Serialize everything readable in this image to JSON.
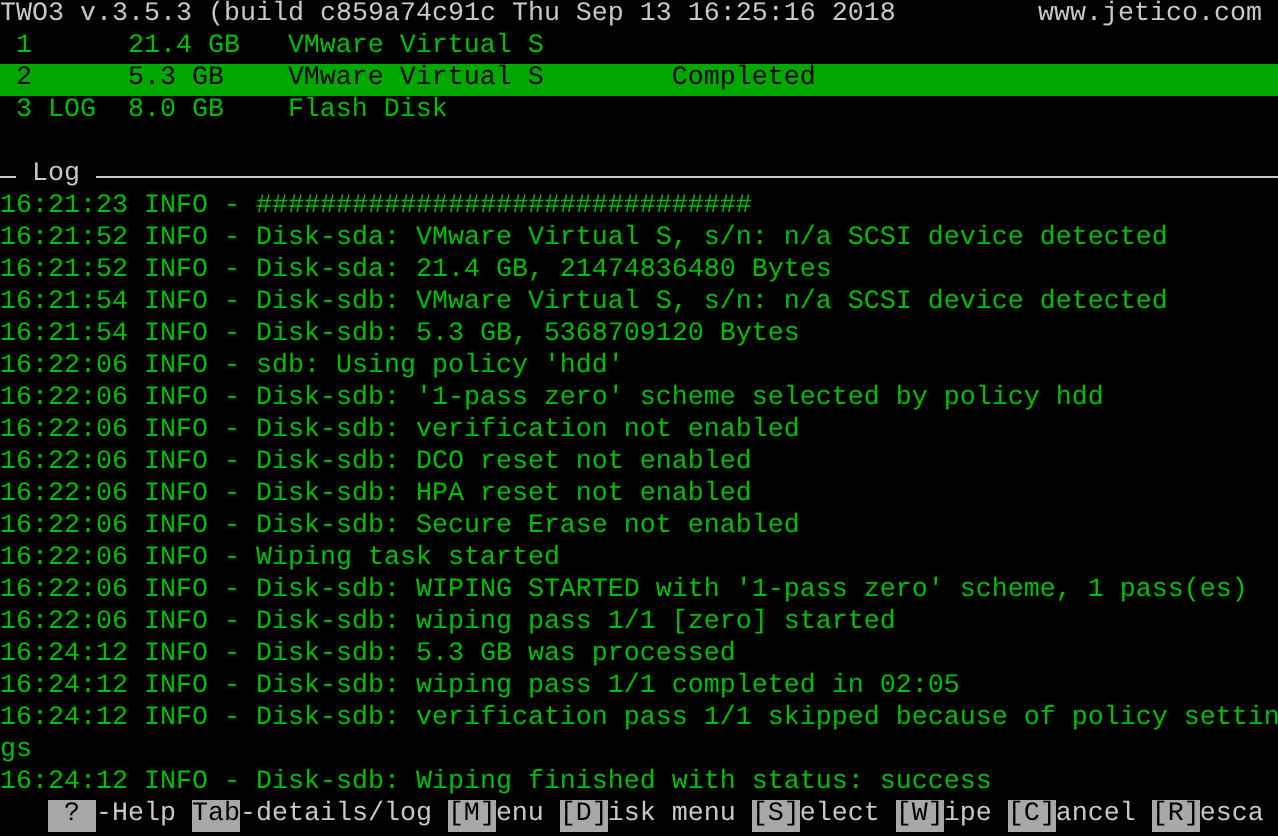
{
  "title_bar": {
    "title": "TWO3 v.3.5.3 (build c859a74c91c Thu Sep 13 16:25:16 2018",
    "website": "www.jetico.com"
  },
  "disks": [
    {
      "id": "1",
      "size": "21.4 GB",
      "name": "VMware Virtual S",
      "selected": false
    },
    {
      "id": "2",
      "size": "5.3 GB",
      "name": "VMware Virtual S",
      "status": "Completed",
      "selected": true
    },
    {
      "id": "3 LOG",
      "size": "8.0 GB",
      "name": "Flash Disk",
      "selected": false
    }
  ],
  "log": {
    "title": "Log",
    "lines": [
      "16:21:23 INFO - ###############################",
      "16:21:52 INFO - Disk-sda: VMware Virtual S, s/n: n/a SCSI device detected",
      "16:21:52 INFO - Disk-sda: 21.4 GB, 21474836480 Bytes",
      "16:21:54 INFO - Disk-sdb: VMware Virtual S, s/n: n/a SCSI device detected",
      "16:21:54 INFO - Disk-sdb: 5.3 GB, 5368709120 Bytes",
      "16:22:06 INFO - sdb: Using policy 'hdd'",
      "16:22:06 INFO - Disk-sdb: '1-pass zero' scheme selected by policy hdd",
      "16:22:06 INFO - Disk-sdb: verification not enabled",
      "16:22:06 INFO - Disk-sdb: DCO reset not enabled",
      "16:22:06 INFO - Disk-sdb: HPA reset not enabled",
      "16:22:06 INFO - Disk-sdb: Secure Erase not enabled",
      "16:22:06 INFO - Wiping task started",
      "16:22:06 INFO - Disk-sdb: WIPING STARTED with '1-pass zero' scheme, 1 pass(es)",
      "16:22:06 INFO - Disk-sdb: wiping pass 1/1 [zero] started",
      "16:24:12 INFO - Disk-sdb: 5.3 GB was processed",
      "16:24:12 INFO - Disk-sdb: wiping pass 1/1 completed in 02:05",
      "16:24:12 INFO - Disk-sdb: verification pass 1/1 skipped because of policy settin",
      "gs",
      "16:24:12 INFO - Disk-sdb: Wiping finished with status: success"
    ]
  },
  "key_bar": [
    {
      "key": " ? ",
      "label": "-Help"
    },
    {
      "key": "Tab",
      "label": "-details/log"
    },
    {
      "key": "[M]",
      "label": "enu"
    },
    {
      "key": "[D]",
      "label": "isk menu"
    },
    {
      "key": "[S]",
      "label": "elect"
    },
    {
      "key": "[W]",
      "label": "ipe"
    },
    {
      "key": "[C]",
      "label": "ancel"
    },
    {
      "key": "[R]",
      "label": "esca"
    }
  ]
}
